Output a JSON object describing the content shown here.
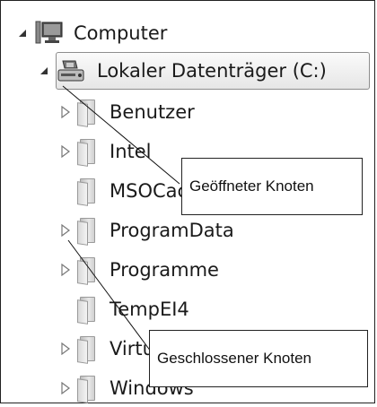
{
  "tree": {
    "computer": {
      "label": "Computer",
      "expanded": true,
      "icon": "computer-icon"
    },
    "drive": {
      "label": "Lokaler Datenträger (C:)",
      "expanded": true,
      "icon": "drive-icon"
    },
    "folders": [
      {
        "label": "Benutzer",
        "has_children": true
      },
      {
        "label": "Intel",
        "has_children": true
      },
      {
        "label": "MSOCache",
        "has_children": false
      },
      {
        "label": "ProgramData",
        "has_children": true
      },
      {
        "label": "Programme",
        "has_children": true
      },
      {
        "label": "TempEI4",
        "has_children": false
      },
      {
        "label": "Virtual",
        "has_children": true
      },
      {
        "label": "Windows",
        "has_children": true
      }
    ]
  },
  "callouts": {
    "opened_node": "Geöffneter Knoten",
    "closed_node": "Geschlossener Knoten"
  }
}
